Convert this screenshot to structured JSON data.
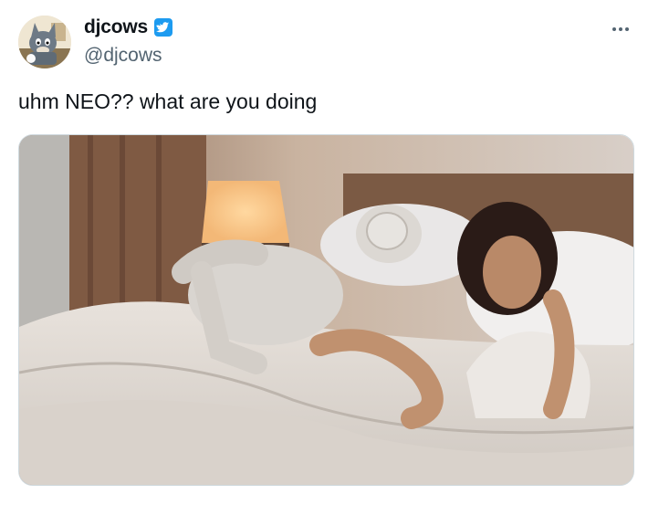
{
  "tweet": {
    "author_name": "djcows",
    "author_handle": "@djcows",
    "verified_icon": "verified-badge-icon",
    "more_icon": "more-options-icon",
    "text": "uhm NEO?? what are you doing"
  },
  "colors": {
    "verified": "#1d9bf0",
    "handle": "#536471",
    "text": "#0f1419"
  }
}
